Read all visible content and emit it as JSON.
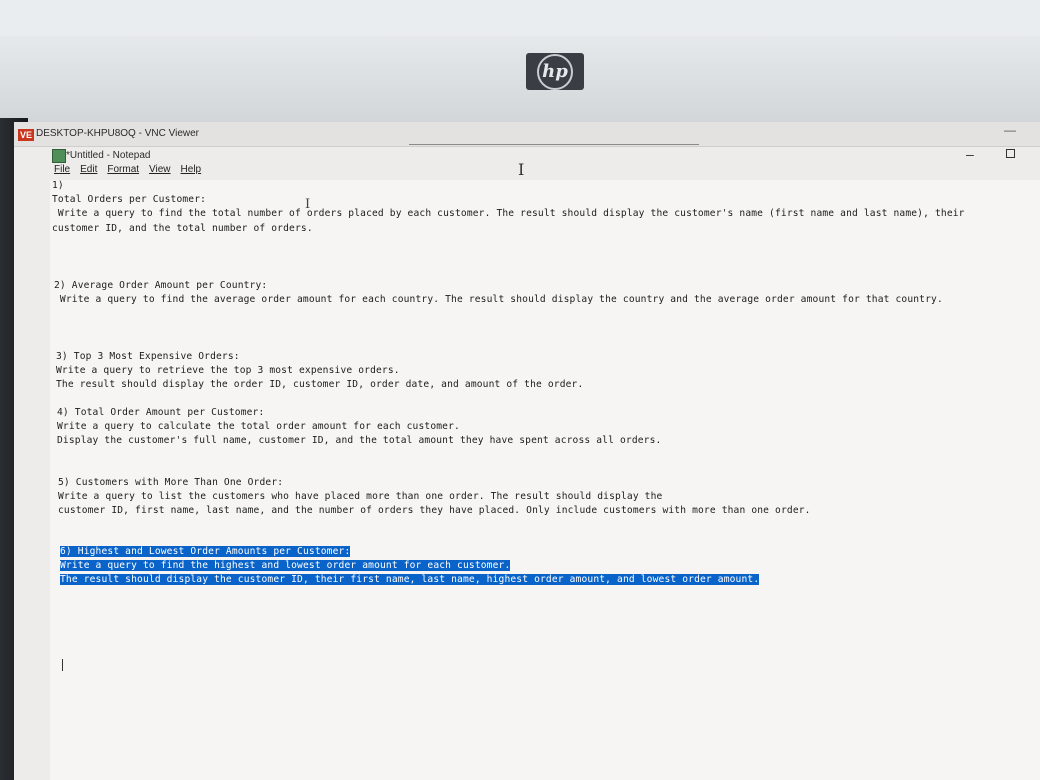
{
  "brand": "hp",
  "vnc": {
    "title": "DESKTOP-KHPU8OQ - VNC Viewer",
    "icon_label": "VE",
    "minimize": "—"
  },
  "notepad": {
    "title": "*Untitled - Notepad",
    "minimize": "–",
    "menu": [
      "File",
      "Edit",
      "Format",
      "View",
      "Help"
    ]
  },
  "content": {
    "l1": "1)",
    "l2": "Total Orders per Customer:",
    "l3": " Write a query to find the total number of orders placed by each customer. The result should display the customer's name (first name and last name), their",
    "l4": "customer ID, and the total number of orders.",
    "l5": "2) Average Order Amount per Country:",
    "l6": " Write a query to find the average order amount for each country. The result should display the country and the average order amount for that country.",
    "l7": "3) Top 3 Most Expensive Orders:",
    "l8": "Write a query to retrieve the top 3 most expensive orders.",
    "l9": "The result should display the order ID, customer ID, order date, and amount of the order.",
    "l10": "4) Total Order Amount per Customer:",
    "l11": "Write a query to calculate the total order amount for each customer.",
    "l12": "Display the customer's full name, customer ID, and the total amount they have spent across all orders.",
    "l13": "5) Customers with More Than One Order:",
    "l14": "Write a query to list the customers who have placed more than one order. The result should display the",
    "l15": "customer ID, first name, last name, and the number of orders they have placed. Only include customers with more than one order.",
    "l16": "6) Highest and Lowest Order Amounts per Customer:",
    "l17": "Write a query to find the highest and lowest order amount for each customer.",
    "l18": "The result should display the customer ID, their first name, last name, highest order amount, and lowest order amount."
  }
}
